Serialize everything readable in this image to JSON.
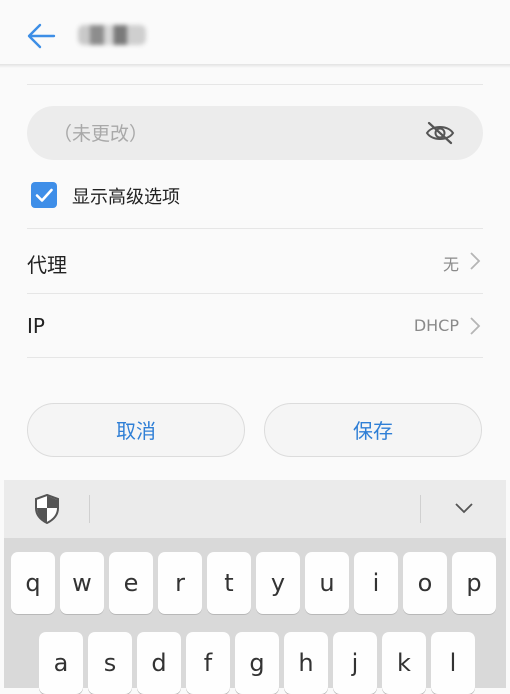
{
  "password": {
    "placeholder": "（未更改）",
    "value": ""
  },
  "advanced_checkbox": {
    "checked": true,
    "label": "显示高级选项"
  },
  "rows": [
    {
      "label": "代理",
      "value": "无"
    },
    {
      "label": "IP",
      "value": "DHCP"
    }
  ],
  "buttons": {
    "cancel": "取消",
    "save": "保存"
  },
  "keyboard": {
    "row1": [
      "q",
      "w",
      "e",
      "r",
      "t",
      "y",
      "u",
      "i",
      "o",
      "p"
    ],
    "row2": [
      "a",
      "s",
      "d",
      "f",
      "g",
      "h",
      "j",
      "k",
      "l"
    ]
  },
  "colors": {
    "accent": "#2f7fd6",
    "checkbox": "#3e8ee8",
    "background": "#fafafa"
  },
  "icons": {
    "back": "arrow-left-icon",
    "password_toggle": "eye-off-icon",
    "keyboard_security": "shield-icon",
    "keyboard_collapse": "chevron-down-icon"
  }
}
